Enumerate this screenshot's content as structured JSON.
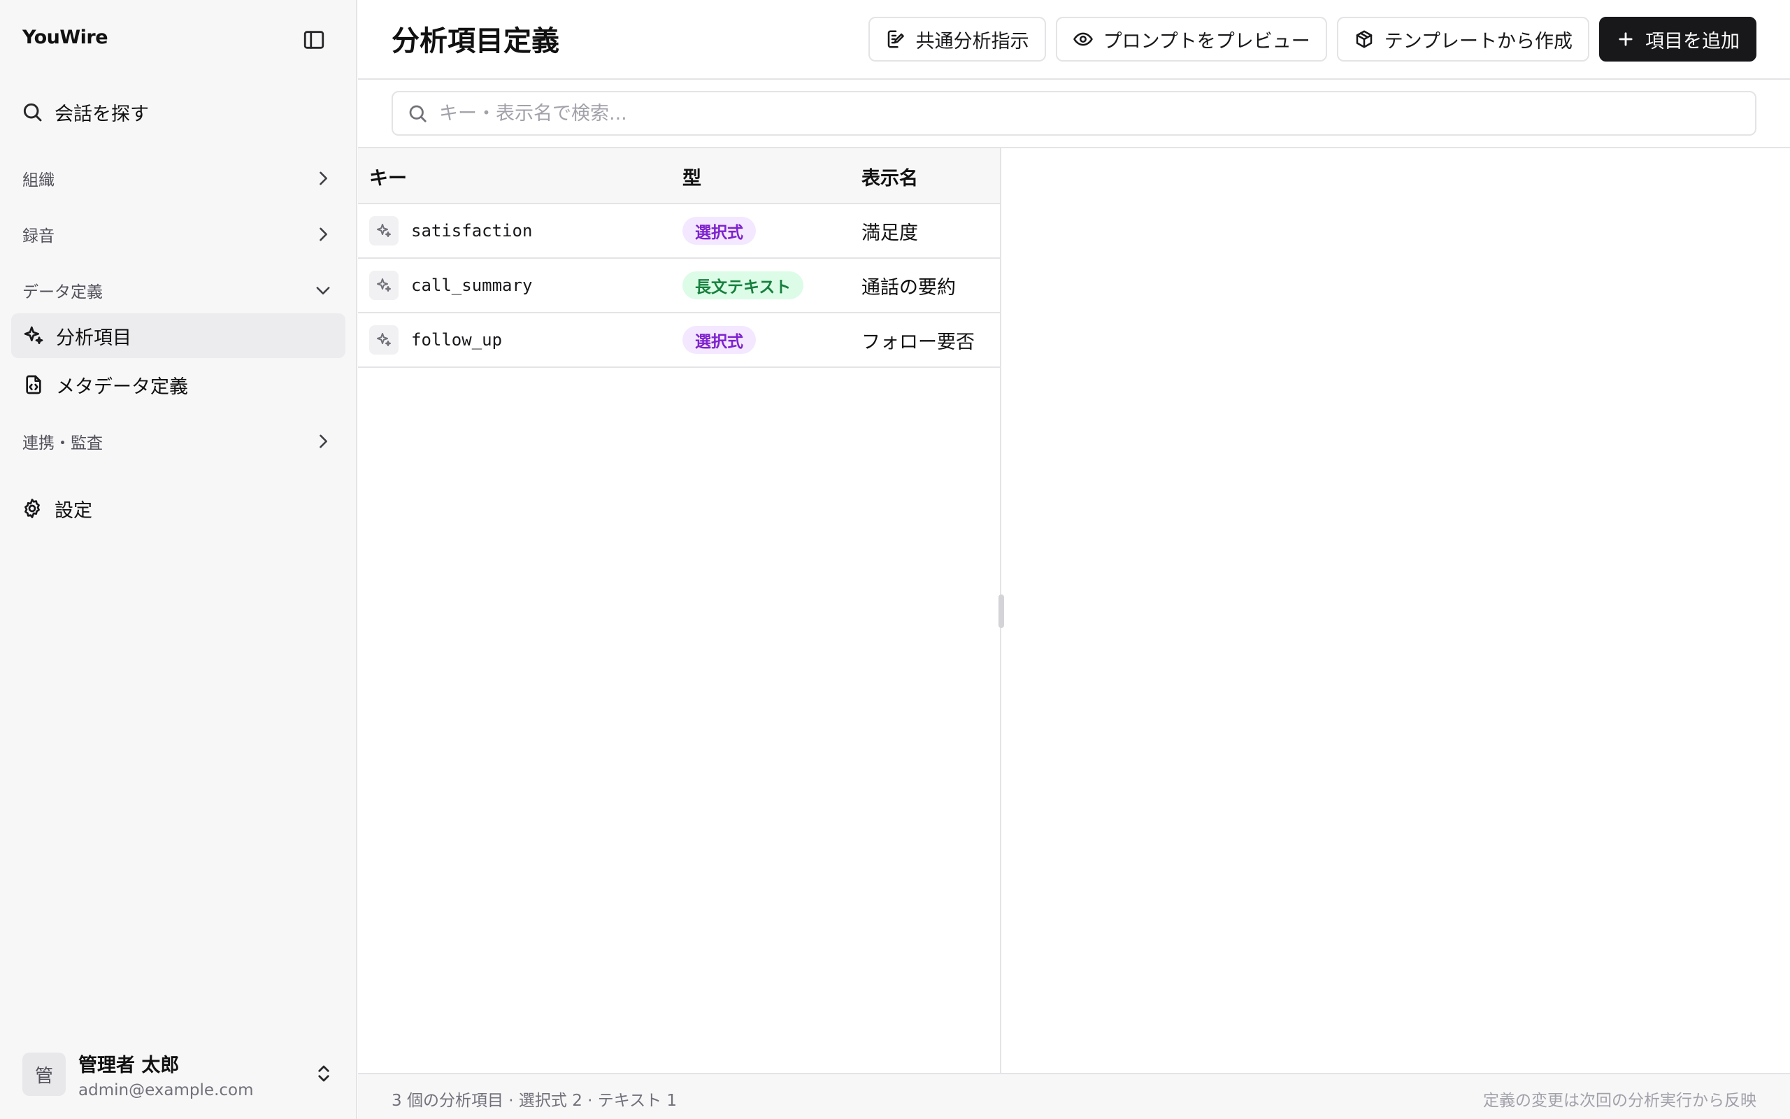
{
  "app": {
    "brand": "YouWire"
  },
  "sidebar": {
    "search_label": "会話を探す",
    "sections": {
      "org": "組織",
      "recording": "録音",
      "data_def": "データ定義",
      "integration": "連携・監査"
    },
    "items": {
      "analysis": "分析項目",
      "metadata": "メタデータ定義"
    },
    "settings": "設定",
    "user": {
      "avatar": "管",
      "name": "管理者 太郎",
      "email": "admin@example.com"
    }
  },
  "header": {
    "title": "分析項目定義",
    "buttons": {
      "common": "共通分析指示",
      "preview": "プロンプトをプレビュー",
      "template": "テンプレートから作成",
      "add": "項目を追加"
    }
  },
  "search": {
    "placeholder": "キー・表示名で検索..."
  },
  "table": {
    "columns": {
      "key": "キー",
      "type": "型",
      "display": "表示名"
    },
    "rows": [
      {
        "key": "satisfaction",
        "type": "選択式",
        "type_kind": "select",
        "display": "満足度"
      },
      {
        "key": "call_summary",
        "type": "長文テキスト",
        "type_kind": "longtext",
        "display": "通話の要約"
      },
      {
        "key": "follow_up",
        "type": "選択式",
        "type_kind": "select",
        "display": "フォロー要否"
      }
    ]
  },
  "footer": {
    "summary": "3 個の分析項目 · 選択式 2 · テキスト 1",
    "note": "定義の変更は次回の分析実行から反映"
  },
  "colors": {
    "select_badge_bg": "#f3e8ff",
    "select_badge_fg": "#7e22ce",
    "longtext_badge_bg": "#dcfce7",
    "longtext_badge_fg": "#15803d",
    "primary": "#18181b"
  }
}
